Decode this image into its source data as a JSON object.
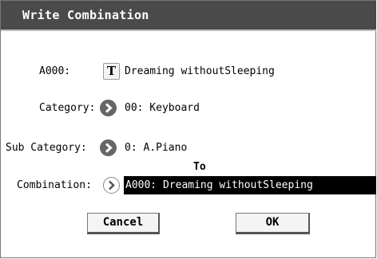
{
  "dialog": {
    "title": "Write Combination"
  },
  "fields": {
    "name_label": "A000:",
    "name_button": "T",
    "name_value": "Dreaming withoutSleeping",
    "category_label": "Category:",
    "category_value": "00: Keyboard",
    "subcategory_label": "Sub Category:",
    "subcategory_value": "0: A.Piano",
    "to_label": "To",
    "combination_label": "Combination:",
    "combination_value": "A000: Dreaming withoutSleeping"
  },
  "buttons": {
    "cancel": "Cancel",
    "ok": "OK"
  },
  "colors": {
    "titlebar": "#4a4a4a",
    "popup_icon": "#666666",
    "selected_field": "#000000"
  },
  "icons": {
    "category_popup": "chevron-right-circle-icon",
    "subcategory_popup": "chevron-right-circle-icon",
    "combination_popup": "chevron-right-circle-outline-icon"
  }
}
